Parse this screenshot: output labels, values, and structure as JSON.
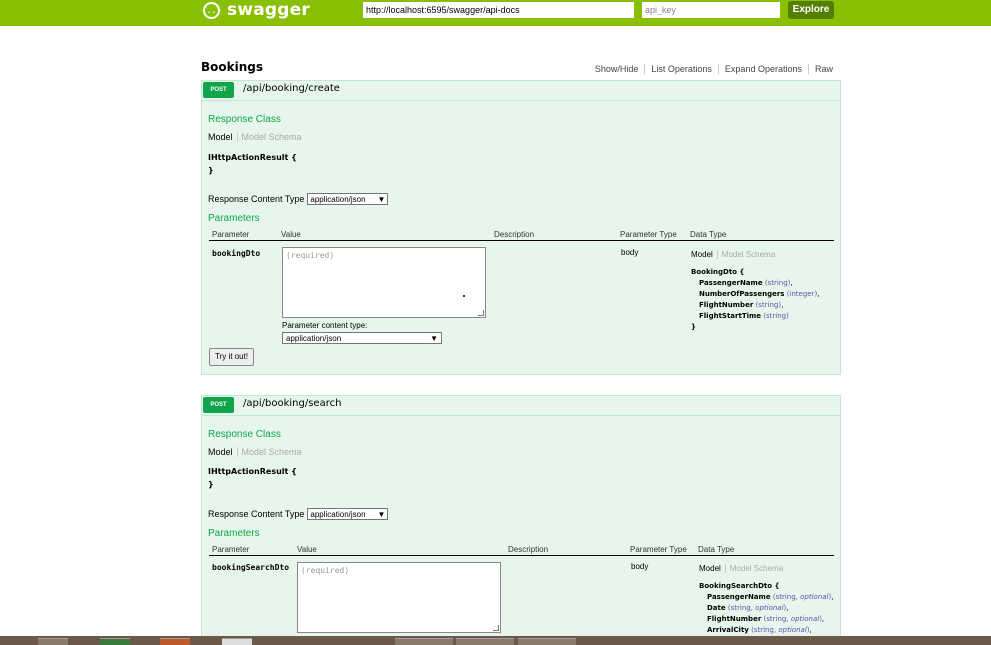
{
  "header": {
    "logo_icon": "{..}",
    "logo_text": "swagger",
    "url_value": "http://localhost:6595/swagger/api-docs",
    "api_key_placeholder": "api_key",
    "explore_label": "Explore"
  },
  "resource": {
    "title": "Bookings",
    "links": [
      "Show/Hide",
      "List Operations",
      "Expand Operations",
      "Raw"
    ]
  },
  "operations": [
    {
      "verb": "POST",
      "path": "/api/booking/create",
      "response_class_label": "Response Class",
      "tab_model": "Model",
      "tab_schema": "Model Schema",
      "response_model_open": "IHttpActionResult {",
      "response_model_close": "}",
      "content_type_label": "Response Content Type",
      "content_type_value": "application/json",
      "parameters_label": "Parameters",
      "columns": [
        "Parameter",
        "Value",
        "Description",
        "Parameter Type",
        "Data Type"
      ],
      "param_name": "bookingDto",
      "param_placeholder": "(required)",
      "param_type": "body",
      "model_name": "BookingDto {",
      "model_props": [
        {
          "name": "PassengerName",
          "type": "string",
          "optional": false
        },
        {
          "name": "NumberOfPassengers",
          "type": "integer",
          "optional": false
        },
        {
          "name": "FlightNumber",
          "type": "string",
          "optional": false
        },
        {
          "name": "FlightStartTime",
          "type": "string",
          "optional": false
        }
      ],
      "model_close": "}",
      "param_content_type_label": "Parameter content type:",
      "param_content_type_value": "application/json",
      "try_label": "Try it out!"
    },
    {
      "verb": "POST",
      "path": "/api/booking/search",
      "response_class_label": "Response Class",
      "tab_model": "Model",
      "tab_schema": "Model Schema",
      "response_model_open": "IHttpActionResult {",
      "response_model_close": "}",
      "content_type_label": "Response Content Type",
      "content_type_value": "application/json",
      "parameters_label": "Parameters",
      "columns": [
        "Parameter",
        "Value",
        "Description",
        "Parameter Type",
        "Data Type"
      ],
      "param_name": "bookingSearchDto",
      "param_placeholder": "(required)",
      "param_type": "body",
      "model_name": "BookingSearchDto {",
      "model_props": [
        {
          "name": "PassengerName",
          "type": "string",
          "optional": true
        },
        {
          "name": "Date",
          "type": "string",
          "optional": true
        },
        {
          "name": "FlightNumber",
          "type": "string",
          "optional": true
        },
        {
          "name": "ArrivalCity",
          "type": "string",
          "optional": true
        }
      ],
      "optional_word": "optional"
    }
  ],
  "colors": {
    "header_bg": "#89bf04",
    "explore_bg": "#547f00",
    "post_badge": "#10a54a",
    "op_bg": "#e7f6ec"
  }
}
